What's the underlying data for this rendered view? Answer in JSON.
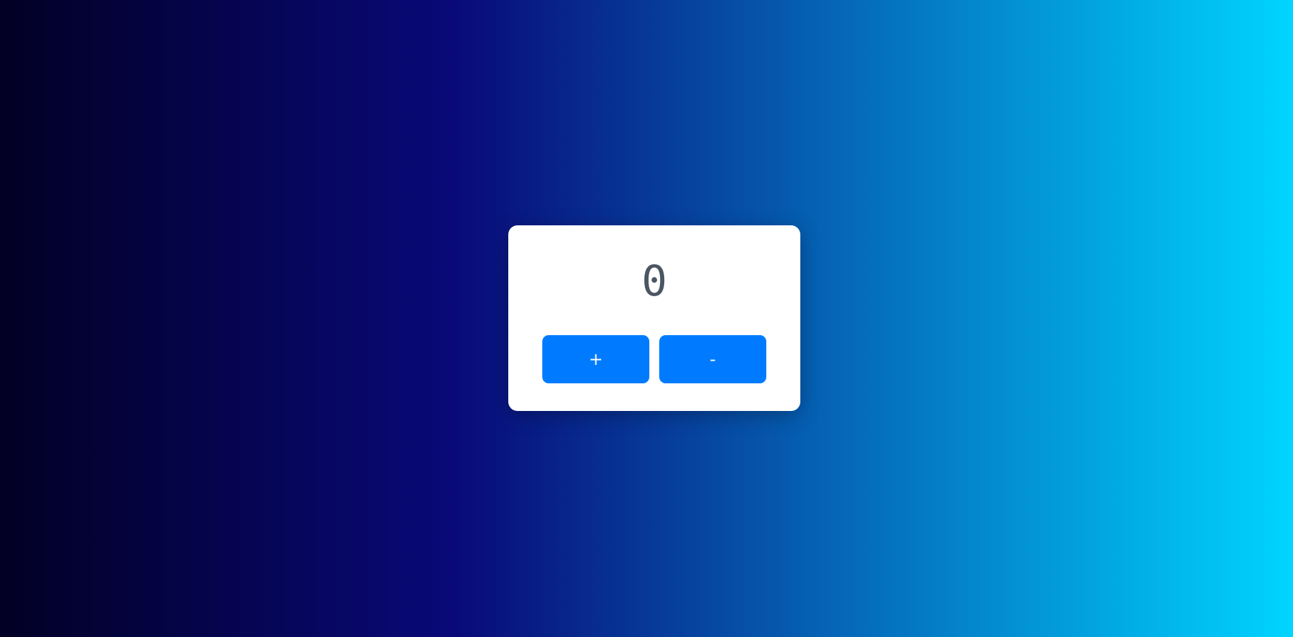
{
  "counter": {
    "value": "0",
    "increment_label": "+",
    "decrement_label": "-"
  },
  "colors": {
    "background_gradient": [
      "#020024",
      "#090979",
      "#00d4ff"
    ],
    "card": "#ffffff",
    "value_text": "#4b5563",
    "button": "#007bff",
    "button_text": "#ffffff"
  }
}
